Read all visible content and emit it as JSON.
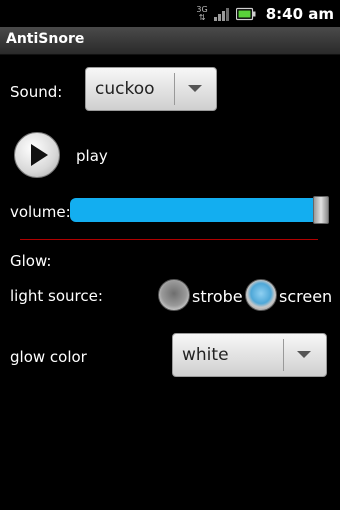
{
  "status_bar": {
    "network_label": "3G",
    "time": "8:40 am",
    "icons": [
      "network-3g-icon",
      "signal-icon",
      "battery-icon"
    ]
  },
  "app": {
    "title": "AntiSnore"
  },
  "sound": {
    "label": "Sound:",
    "selected": "cuckoo"
  },
  "play": {
    "label": "play"
  },
  "volume": {
    "label": "volume:",
    "level": 0.98
  },
  "glow": {
    "heading": "Glow:",
    "light_source": {
      "label": "light source:",
      "options": [
        {
          "label": "strobe",
          "checked": false
        },
        {
          "label": "screen",
          "checked": true
        }
      ]
    },
    "color": {
      "label": "glow color",
      "selected": "white"
    }
  },
  "colors": {
    "accent": "#13aef0",
    "separator": "#b00000",
    "background": "#000000"
  }
}
